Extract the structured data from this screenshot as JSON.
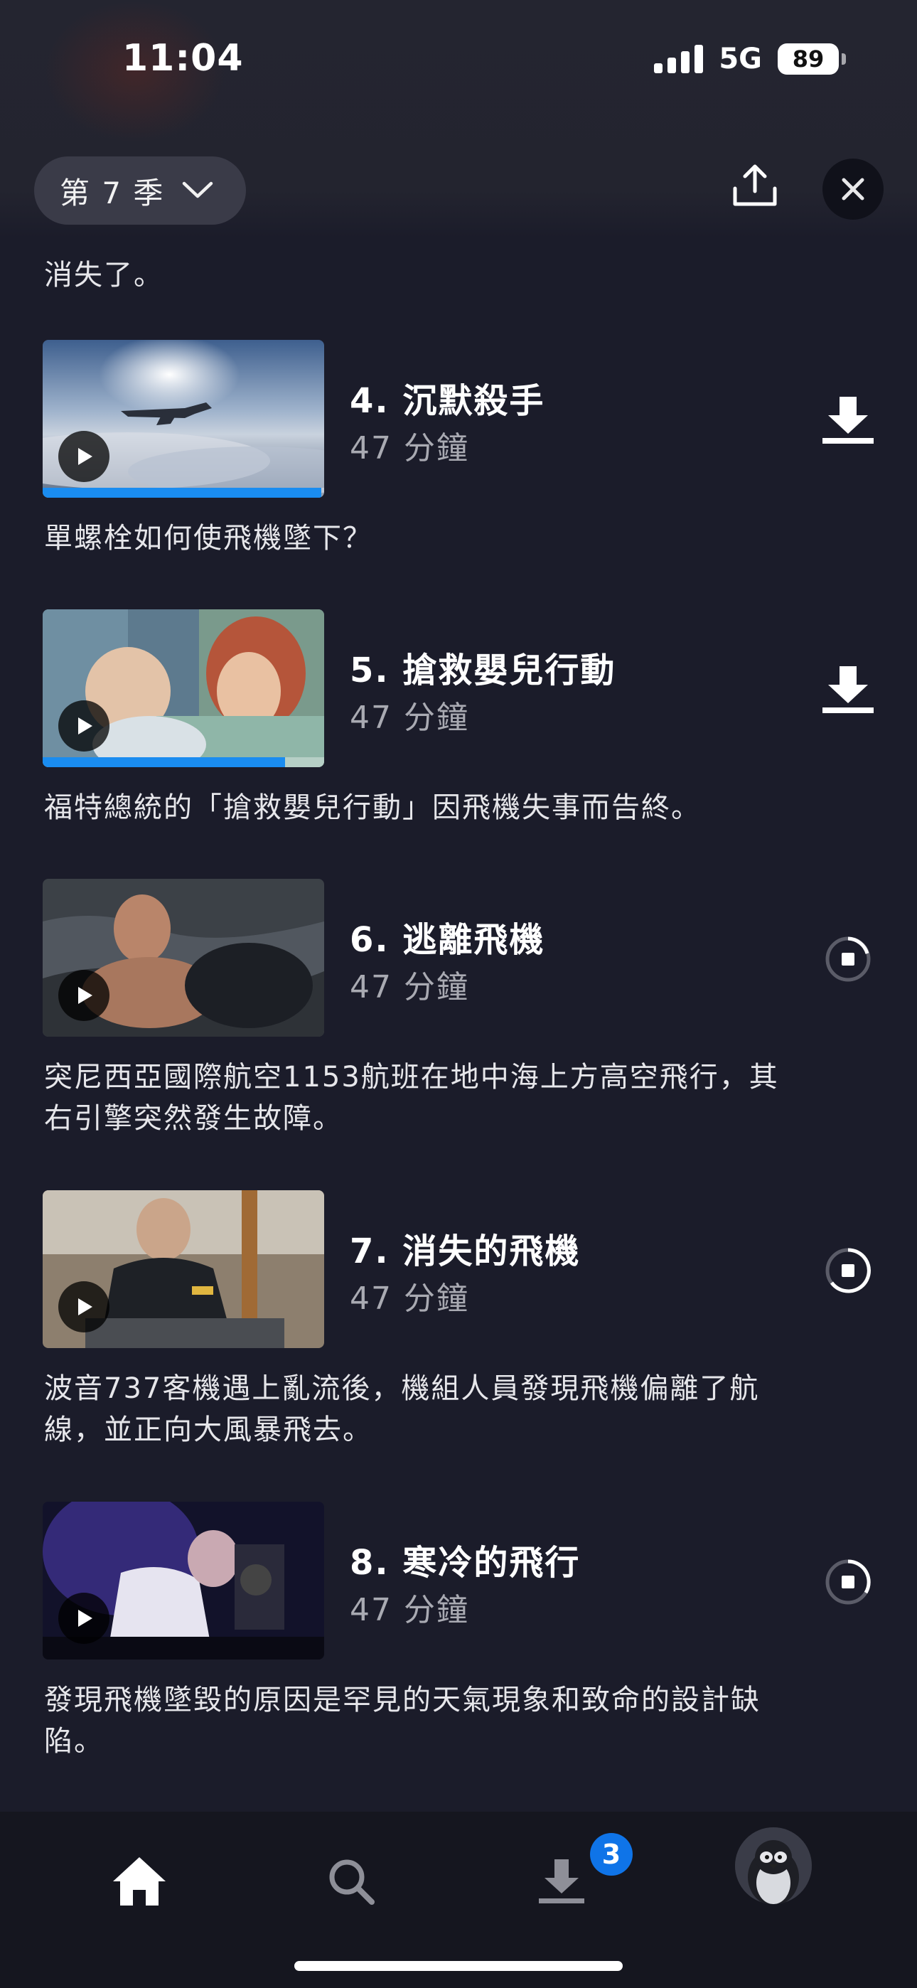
{
  "status_bar": {
    "time": "11:04",
    "network": "5G",
    "battery": "89"
  },
  "header": {
    "season_label": "第 7 季",
    "icons": [
      "chevron-down-icon",
      "share-icon",
      "close-icon"
    ]
  },
  "previous_description": "消失了。",
  "episodes": [
    {
      "title": "4. 沉默殺手",
      "duration": "47 分鐘",
      "description": "單螺栓如何使飛機墜下？",
      "watched_fraction": 0.99,
      "action_icon": "download-icon"
    },
    {
      "title": "5. 搶救嬰兒行動",
      "duration": "47 分鐘",
      "description": "福特總統的「搶救嬰兒行動」因飛機失事而告終。",
      "watched_fraction": 0.86,
      "action_icon": "download-icon"
    },
    {
      "title": "6. 逃離飛機",
      "duration": "47 分鐘",
      "description_lines": [
        "突尼西亞國際航空1153航班在地中海上方高空飛行，其",
        "右引擎突然發生故障。"
      ],
      "action_icon": "download-progress-icon"
    },
    {
      "title": "7. 消失的飛機",
      "duration": "47 分鐘",
      "description_lines": [
        "波音737客機遇上亂流後，機組人員發現飛機偏離了航",
        "線，並正向大風暴飛去。"
      ],
      "action_icon": "download-progress-icon"
    },
    {
      "title": "8. 寒冷的飛行",
      "duration": "47 分鐘",
      "description_lines": [
        "發現飛機墜毀的原因是罕見的天氣現象和致命的設計缺",
        "陷。"
      ],
      "action_icon": "download-progress-icon"
    }
  ],
  "tab_bar": {
    "items": [
      "home-icon",
      "search-icon",
      "downloads-icon",
      "profile-avatar"
    ],
    "downloads_badge": "3"
  },
  "colors": {
    "background": "#1b1c2a",
    "accent": "#1a8cf0",
    "badge": "#0f74e8"
  }
}
